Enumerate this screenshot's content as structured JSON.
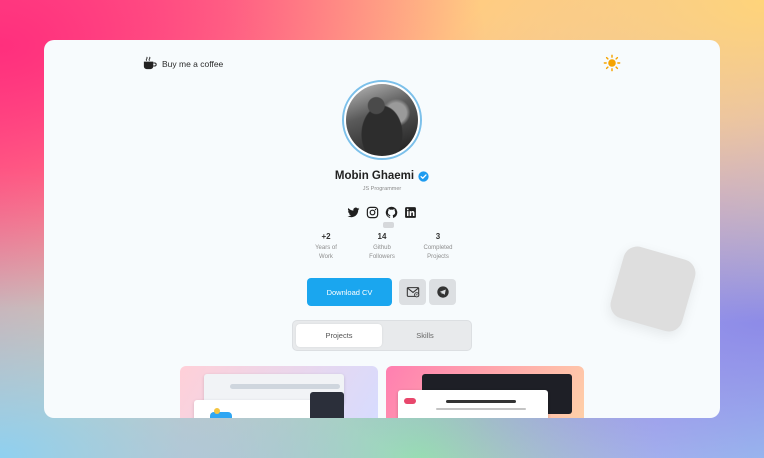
{
  "header": {
    "coffee_label": "Buy me a coffee",
    "coffee_icon": "coffee-cup-icon",
    "theme_icon": "sun-icon"
  },
  "profile": {
    "name": "Mobin Ghaemi",
    "role": "JS Programmer",
    "verified_icon": "verified-badge-icon"
  },
  "socials": [
    {
      "icon": "twitter-icon"
    },
    {
      "icon": "instagram-icon"
    },
    {
      "icon": "github-icon"
    },
    {
      "icon": "linkedin-icon"
    }
  ],
  "stats": [
    {
      "value": "+2",
      "label_line1": "Years of",
      "label_line2": "Work"
    },
    {
      "value": "14",
      "label_line1": "Github",
      "label_line2": "Followers"
    },
    {
      "value": "3",
      "label_line1": "Completed",
      "label_line2": "Projects"
    }
  ],
  "actions": {
    "download_cv_label": "Download CV",
    "email_icon": "mail-icon",
    "telegram_icon": "telegram-icon"
  },
  "tabs": [
    {
      "label": "Projects",
      "active": true
    },
    {
      "label": "Skills",
      "active": false
    }
  ],
  "colors": {
    "accent": "#1aa6ef",
    "card_bg": "#f7fbfd",
    "verified": "#1d9bf0",
    "sun": "#f5a300"
  }
}
